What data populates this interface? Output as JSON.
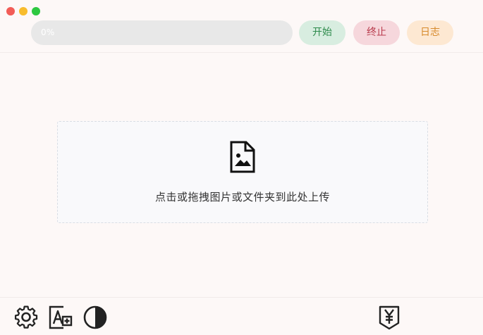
{
  "header": {
    "progress": {
      "value": 0,
      "label": "0%"
    },
    "buttons": {
      "start_label": "开始",
      "stop_label": "终止",
      "log_label": "日志"
    }
  },
  "dropzone": {
    "icon": "file-image-icon",
    "hint": "点击或拖拽图片或文件夹到此处上传"
  },
  "footer": {
    "tools": [
      "gear-icon",
      "font-size-icon",
      "contrast-icon",
      "yen-icon"
    ]
  },
  "colors": {
    "background": "#fdf8f7",
    "start": "#2d8a4b",
    "stop": "#b83a4b",
    "log": "#d78a2c"
  }
}
